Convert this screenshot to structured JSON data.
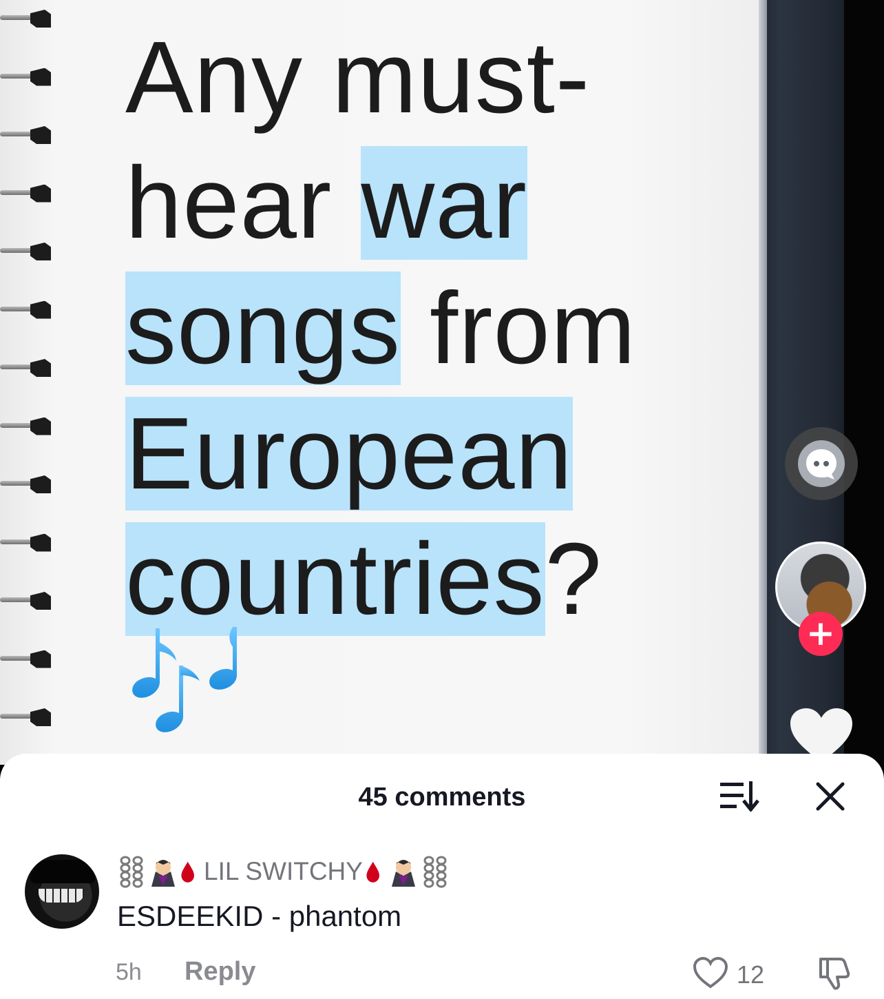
{
  "video": {
    "question_lines": [
      [
        {
          "text": "Any must-",
          "hl": false
        }
      ],
      [
        {
          "text": "hear ",
          "hl": false
        },
        {
          "text": "war",
          "hl": true
        }
      ],
      [
        {
          "text": "songs",
          "hl": true
        },
        {
          "text": " from",
          "hl": false
        }
      ],
      [
        {
          "text": "European",
          "hl": true
        }
      ],
      [
        {
          "text": "countries",
          "hl": true
        },
        {
          "text": "?",
          "hl": false
        }
      ]
    ],
    "highlight_color": "#b8e3fb",
    "notes_icon": "musical-notes-emoji",
    "side_actions": {
      "comment_icon": "chat-bubble-icon",
      "follow_label": "+",
      "like_icon": "heart-icon"
    }
  },
  "sheet": {
    "title": "45 comments",
    "sort_icon": "sort-icon",
    "close_icon": "close-icon"
  },
  "comment": {
    "username": "LIL SWITCHY",
    "username_decorations": [
      "chains-emoji",
      "vampire-emoji",
      "blood-drop-emoji"
    ],
    "text": "ESDEEKID - phantom",
    "time": "5h",
    "reply_label": "Reply",
    "like_count": "12"
  },
  "colors": {
    "accent_red": "#fe2c55",
    "text_primary": "#161823",
    "text_secondary": "#8a8b91"
  }
}
